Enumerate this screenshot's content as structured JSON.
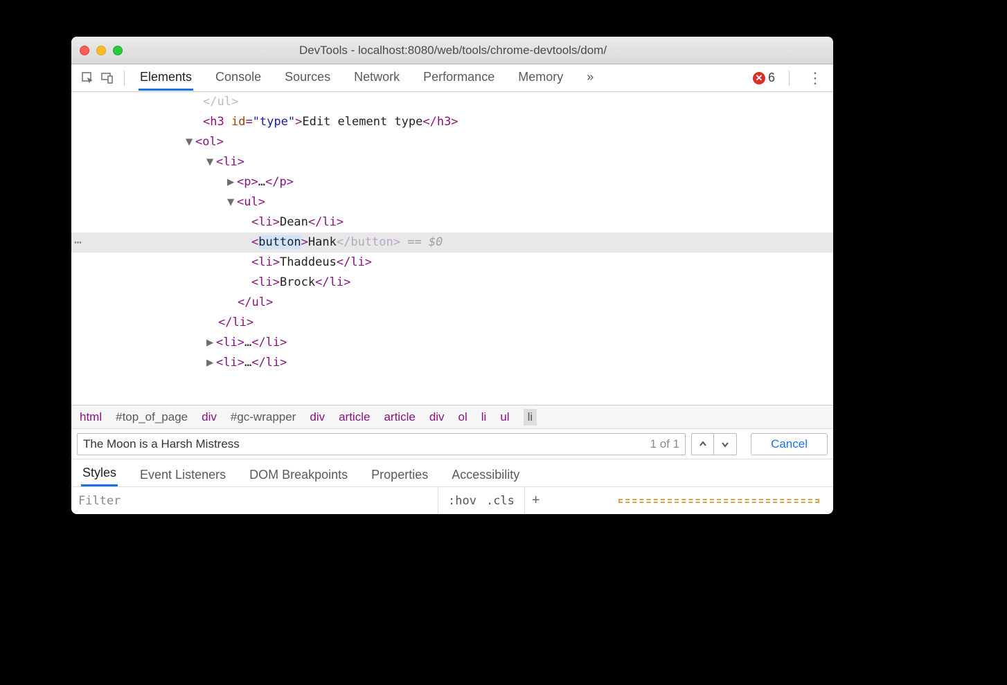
{
  "window": {
    "title": "DevTools - localhost:8080/web/tools/chrome-devtools/dom/"
  },
  "tabs": {
    "elements": "Elements",
    "console": "Console",
    "sources": "Sources",
    "network": "Network",
    "performance": "Performance",
    "memory": "Memory",
    "overflow": "»"
  },
  "errors": {
    "count": "6"
  },
  "dom": {
    "ul_close_fade": "</ul>",
    "h3_open": "<h3 ",
    "h3_attr_name": "id",
    "h3_attr_val": "\"type\"",
    "h3_text": "Edit element type",
    "h3_close": "</h3>",
    "ol_open": "<ol>",
    "li_open": "<li>",
    "p_collapsed": "<p>…</p>",
    "ul_open": "<ul>",
    "li1_open": "<li>",
    "li1_text": "Dean",
    "li1_close": "</li>",
    "sel_open": "<",
    "sel_tag": "button",
    "sel_gt": ">",
    "sel_text": "Hank",
    "sel_close": "</button>",
    "sel_eq": " == $0",
    "li3_open": "<li>",
    "li3_text": "Thaddeus",
    "li3_close": "</li>",
    "li4_open": "<li>",
    "li4_text": "Brock",
    "li4_close": "</li>",
    "ul_close": "</ul>",
    "li_close": "</li>",
    "li_collapsed1": "<li>…</li>",
    "li_collapsed2": "<li>…</li>"
  },
  "breadcrumb": [
    "html",
    "#top_of_page",
    "div",
    "#gc-wrapper",
    "div",
    "article",
    "article",
    "div",
    "ol",
    "li",
    "ul",
    "li"
  ],
  "search": {
    "value": "The Moon is a Harsh Mistress",
    "count": "1 of 1",
    "cancel": "Cancel"
  },
  "subtabs": {
    "styles": "Styles",
    "eventlisteners": "Event Listeners",
    "dombreakpoints": "DOM Breakpoints",
    "properties": "Properties",
    "accessibility": "Accessibility"
  },
  "styles_bar": {
    "filter_placeholder": "Filter",
    "hov": ":hov",
    "cls": ".cls"
  }
}
